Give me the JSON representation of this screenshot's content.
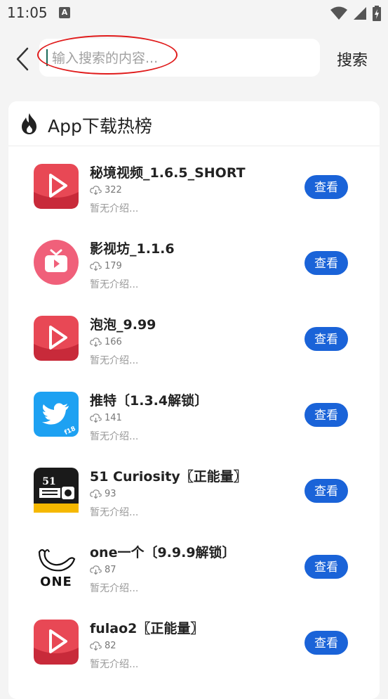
{
  "status_bar": {
    "time": "11:05",
    "notification_letter": "A"
  },
  "search": {
    "placeholder": "输入搜索的内容...",
    "button_label": "搜索"
  },
  "card": {
    "title": "App下载热榜"
  },
  "apps": [
    {
      "name": "秘境视频_1.6.5_SHORT",
      "downloads": "322",
      "description": "暂无介绍...",
      "button": "查看",
      "icon": "red-play-icon"
    },
    {
      "name": "影视坊_1.1.6",
      "downloads": "179",
      "description": "暂无介绍...",
      "button": "查看",
      "icon": "pink-tv-icon"
    },
    {
      "name": "泡泡_9.99",
      "downloads": "166",
      "description": "暂无介绍...",
      "button": "查看",
      "icon": "red-play-icon"
    },
    {
      "name": "推特〔1.3.4解锁〕",
      "downloads": "141",
      "description": "暂无介绍...",
      "button": "查看",
      "icon": "twitter-bird-icon"
    },
    {
      "name": "51 Curiosity〖正能量〗",
      "downloads": "93",
      "description": "暂无介绍...",
      "button": "查看",
      "icon": "51-curiosity-icon"
    },
    {
      "name": "one一个〔9.9.9解锁〕",
      "downloads": "87",
      "description": "暂无介绍...",
      "button": "查看",
      "icon": "one-whale-icon"
    },
    {
      "name": "fulao2〖正能量〗",
      "downloads": "82",
      "description": "暂无介绍...",
      "button": "查看",
      "icon": "red-play-icon"
    }
  ],
  "colors": {
    "accent": "#1a63d8",
    "annotation": "#e01b1b",
    "background": "#f4f4f4"
  }
}
